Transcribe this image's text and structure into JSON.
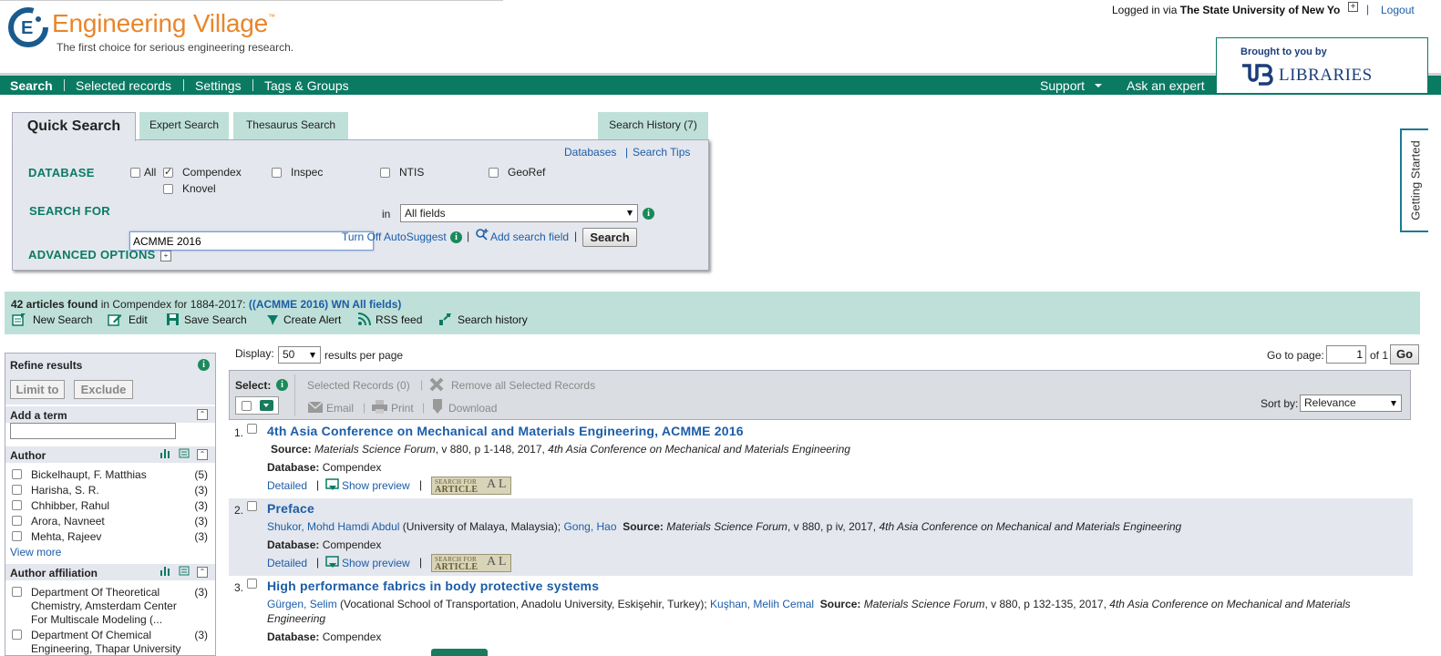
{
  "header": {
    "logo_title": "Engineering Village",
    "logo_tm": "™",
    "tagline": "The first choice for serious engineering research.",
    "login_prefix": "Logged in via",
    "login_institution": "The State University of New Yo",
    "logout": "Logout",
    "brought_by": "Brought to you by",
    "partner": "LIBRARIES"
  },
  "nav": {
    "items": [
      "Search",
      "Selected records",
      "Settings",
      "Tags & Groups"
    ],
    "support": "Support",
    "ask_expert": "Ask an expert"
  },
  "getting_started": "Getting Started",
  "search": {
    "tabs": [
      "Quick Search",
      "Expert Search",
      "Thesaurus Search"
    ],
    "history_tab": "Search History (7)",
    "databases_link": "Databases",
    "tips_link": "Search Tips",
    "database_label": "DATABASE",
    "databases": [
      {
        "label": "All",
        "checked": false
      },
      {
        "label": "Compendex",
        "checked": true
      },
      {
        "label": "Inspec",
        "checked": false
      },
      {
        "label": "NTIS",
        "checked": false
      },
      {
        "label": "GeoRef",
        "checked": false
      },
      {
        "label": "Knovel",
        "checked": false
      }
    ],
    "search_for_label": "SEARCH FOR",
    "query": "ACMME 2016",
    "in_label": "in",
    "field": "All fields",
    "autosuggest": "Turn Off AutoSuggest",
    "add_field": "Add search field",
    "search_button": "Search",
    "advanced": "ADVANCED OPTIONS"
  },
  "results_bar": {
    "count": "42 articles found",
    "scope": " in Compendex for 1884-2017: ",
    "query": "((ACMME 2016) WN All fields)",
    "tools": [
      "New Search",
      "Edit",
      "Save Search",
      "Create Alert",
      "RSS feed",
      "Search history"
    ]
  },
  "refine": {
    "title": "Refine results",
    "limit": "Limit to",
    "exclude": "Exclude",
    "add_term": "Add a term",
    "author_head": "Author",
    "authors": [
      {
        "name": "Bickelhaupt, F. Matthias",
        "count": "(5)"
      },
      {
        "name": "Harisha, S. R.",
        "count": "(3)"
      },
      {
        "name": "Chhibber, Rahul",
        "count": "(3)"
      },
      {
        "name": "Arora, Navneet",
        "count": "(3)"
      },
      {
        "name": "Mehta, Rajeev",
        "count": "(3)"
      }
    ],
    "view_more": "View more",
    "affiliation_head": "Author affiliation",
    "affiliations": [
      {
        "name": "Department Of Theoretical Chemistry, Amsterdam Center For Multiscale Modeling (...",
        "count": "(3)"
      },
      {
        "name": "Department Of Chemical Engineering, Thapar University",
        "count": "(3)"
      }
    ]
  },
  "results": {
    "display_label": "Display:",
    "display_value": "50",
    "per_page": "results per page",
    "goto_label": "Go to page:",
    "goto_value": "1",
    "of_pages": "of 1",
    "go": "Go",
    "select_label": "Select:",
    "selected_records": "Selected Records (0)",
    "remove_all": "Remove all Selected Records",
    "email": "Email",
    "print": "Print",
    "download": "Download",
    "sort_label": "Sort by:",
    "sort_value": "Relevance",
    "detailed": "Detailed",
    "show_preview": "Show preview",
    "sfa_top": "SEARCH FOR",
    "sfa_bottom": "ARTICLE",
    "sfa_al": "A L",
    "source_label": "Source:",
    "database_label": "Database:",
    "items": [
      {
        "num": "1.",
        "title": "4th Asia Conference on Mechanical and Materials Engineering, ACMME 2016",
        "source": "Materials Science Forum",
        "source_detail": ", v 880, p 1-148, 2017, ",
        "conference": "4th Asia Conference on Mechanical and Materials Engineering",
        "database": "Compendex"
      },
      {
        "num": "2.",
        "title": "Preface",
        "author1": "Shukor, Mohd Hamdi Abdul",
        "aff1": " (University of Malaya, Malaysia); ",
        "author2": "Gong, Hao",
        "source": "Materials Science Forum",
        "source_detail": ", v 880, p iv, 2017, ",
        "conference": "4th Asia Conference on Mechanical and Materials Engineering",
        "database": "Compendex"
      },
      {
        "num": "3.",
        "title": "High performance fabrics in body protective systems",
        "author1": "Gürgen, Selim",
        "aff1": " (Vocational School of Transportation, Anadolu University, Eskişehir, Turkey); ",
        "author2": "Kuşhan, Melih Cemal",
        "source": "Materials Science Forum",
        "source_detail": ", v 880, p 132-135, 2017, ",
        "conference": "4th Asia Conference on Mechanical and Materials",
        "conference_cont": "Engineering",
        "database": "Compendex"
      }
    ]
  },
  "colors": {
    "brand_green": "#0b7a63",
    "tab_green": "#bfe0d8",
    "link_blue": "#1c5da8",
    "logo_orange": "#e8862b"
  }
}
